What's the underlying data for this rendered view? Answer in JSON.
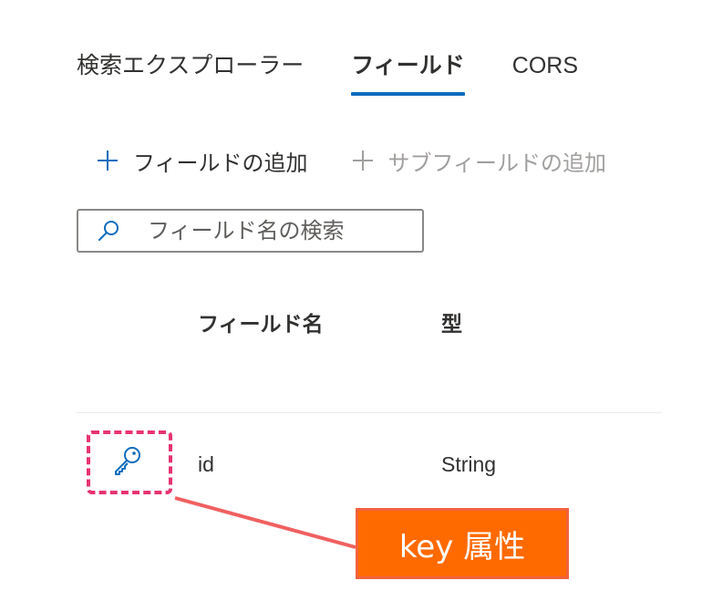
{
  "tabs": [
    {
      "label": "検索エクスプローラー",
      "active": false
    },
    {
      "label": "フィールド",
      "active": true
    },
    {
      "label": "CORS",
      "active": false
    }
  ],
  "commands": {
    "add_field": "フィールドの追加",
    "add_subfield": "サブフィールドの追加"
  },
  "search": {
    "placeholder": "フィールド名の検索",
    "value": ""
  },
  "table": {
    "headers": {
      "name": "フィールド名",
      "type": "型"
    },
    "rows": [
      {
        "name": "id",
        "type": "String",
        "icon": "key-icon",
        "is_key": true
      }
    ]
  },
  "annotation": {
    "label": "key 属性"
  },
  "colors": {
    "accent": "#0f6cbd",
    "highlight": "#e8336f",
    "callout_bg": "#ff6a00",
    "callout_line": "#f06060"
  }
}
